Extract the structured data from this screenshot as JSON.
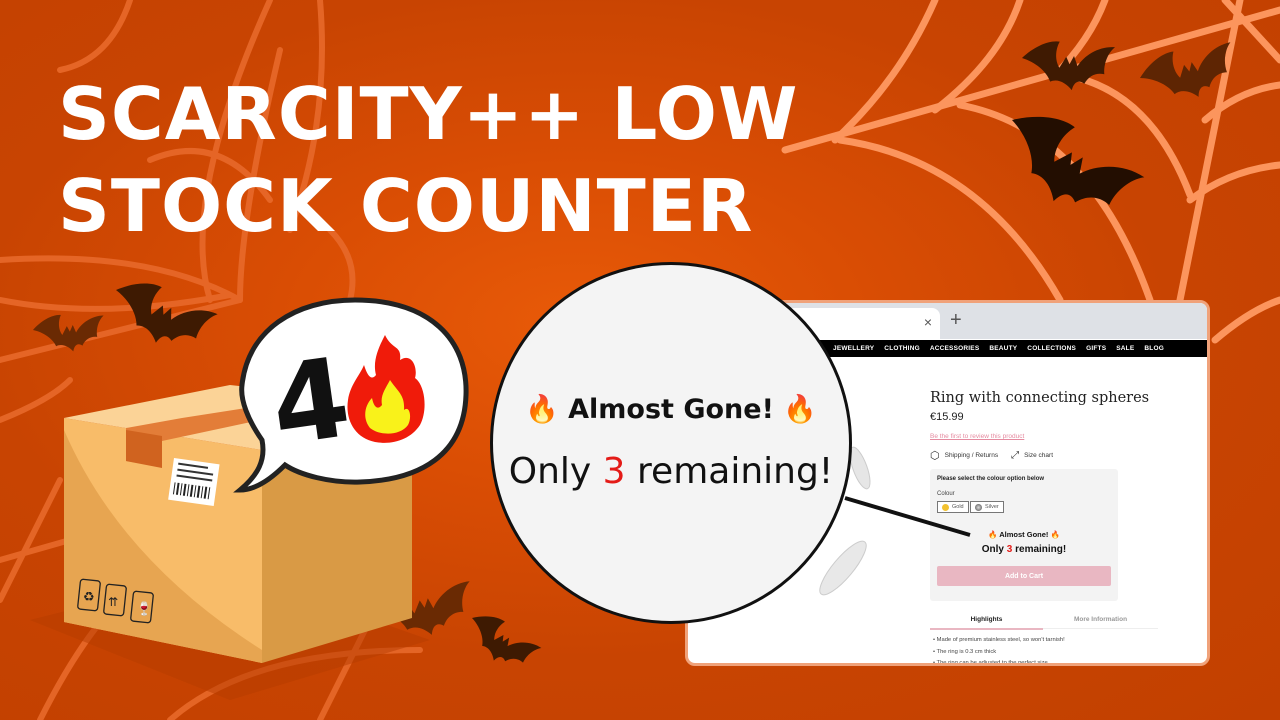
{
  "headline": {
    "line1": "SCARCITY++ LOW",
    "line2": "STOCK COUNTER"
  },
  "speech_bubble": {
    "number": "4",
    "icon": "fire-icon"
  },
  "box_icons": [
    "recycle-icon",
    "this-way-up-icon",
    "fragile-icon"
  ],
  "colors": {
    "background": "#c84402",
    "web": "#ff9a62",
    "accent_red": "#e41b17",
    "add_to_cart": "#e9b7c2",
    "review_link": "#e58ba0"
  },
  "magnifier": {
    "badge_title": "Almost Gone!",
    "badge_emoji": "🔥",
    "remaining_prefix": "Only",
    "remaining_count": "3",
    "remaining_suffix": "remaining!"
  },
  "browser": {
    "tab_close": "×",
    "new_tab": "+",
    "nav_items": [
      "JEWELLERY",
      "CLOTHING",
      "ACCESSORIES",
      "BEAUTY",
      "COLLECTIONS",
      "GIFTS",
      "SALE",
      "BLOG"
    ],
    "product": {
      "title": "Ring with connecting spheres",
      "price": "€15.99",
      "review_link": "Be the first to review this product",
      "shipping_label": "Shipping / Returns",
      "size_chart_label": "Size chart",
      "colour_prompt": "Please select the colour option below",
      "colour_label": "Colour",
      "colour_options": [
        {
          "label": "Gold",
          "swatch": "#f2c12e"
        },
        {
          "label": "Silver",
          "swatch": "#555555"
        }
      ],
      "stock_badge_title": "Almost Gone!",
      "stock_badge_emoji": "🔥",
      "stock_prefix": "Only",
      "stock_count": "3",
      "stock_suffix": "remaining!",
      "add_to_cart": "Add to Cart",
      "tabs": [
        "Highlights",
        "More Information"
      ],
      "active_tab": "Highlights",
      "highlights": [
        "Made of premium stainless steel, so won't tarnish!",
        "The ring is 0.3 cm thick",
        "The ring can be adjusted to the perfect size"
      ]
    }
  }
}
